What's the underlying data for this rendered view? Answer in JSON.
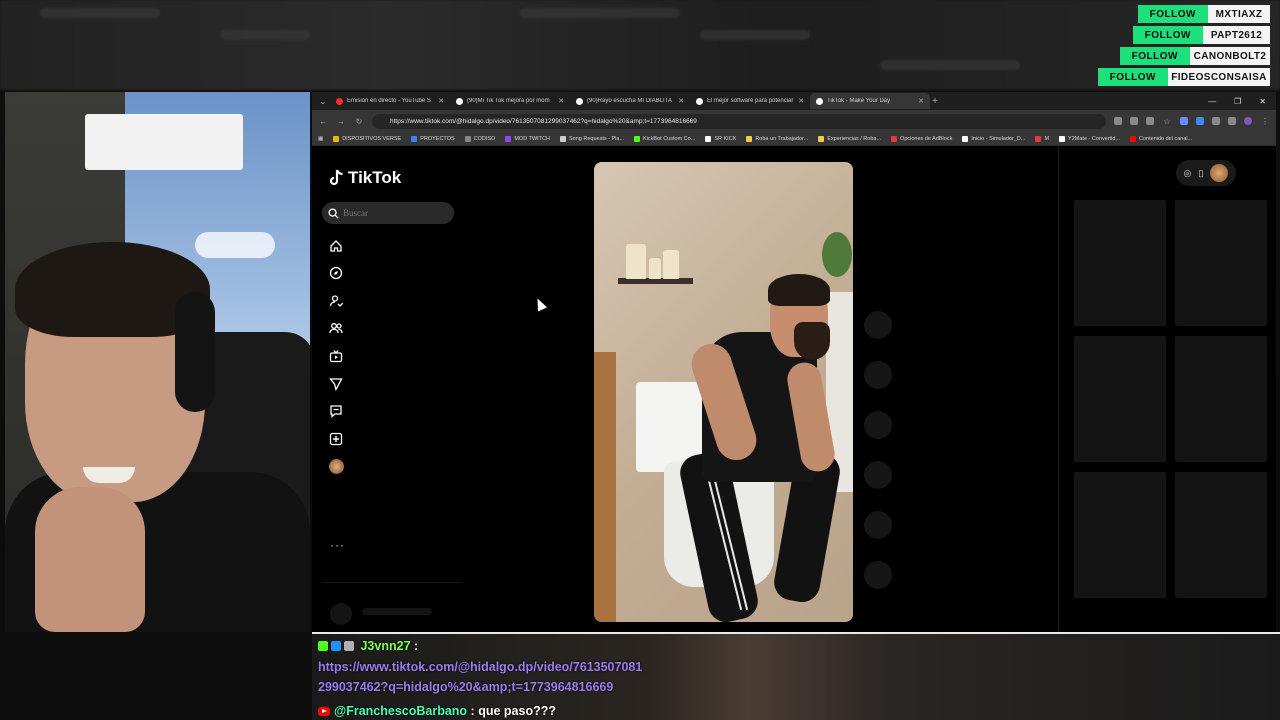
{
  "follows": [
    {
      "action": "FOLLOW",
      "name": "MXTIAXZ"
    },
    {
      "action": "FOLLOW",
      "name": "PAPT2612"
    },
    {
      "action": "FOLLOW",
      "name": "CANONBOLT2"
    },
    {
      "action": "FOLLOW",
      "name": "FIDEOSCONSAISA"
    }
  ],
  "browser": {
    "tabs": [
      {
        "title": "Emisión en directo - YouTube S",
        "favicon_color": "#ff2a2a"
      },
      {
        "title": "(90)Mi Tik Tok mejora por mom",
        "favicon_color": "#ffffff"
      },
      {
        "title": "(90)Rayo escucha MI DIABLITA",
        "favicon_color": "#ffffff"
      },
      {
        "title": "El mejor software para potenciar",
        "favicon_color": "#ffffff"
      },
      {
        "title": "TikTok - Make Your Day",
        "favicon_color": "#ffffff"
      }
    ],
    "new_tab": "+",
    "url": "https://www.tiktok.com/@hidalgo.dp/video/7613507081299037462?q=hidalgo%20&amp;t=1773964816669",
    "bookmarks": [
      {
        "label": "DISPOSITIVOS VERSE",
        "color": "#f0b400"
      },
      {
        "label": "PROYECTOS",
        "color": "#3b82f6"
      },
      {
        "label": "CODISO",
        "color": "#888888"
      },
      {
        "label": "MOD TWITCH",
        "color": "#9146ff"
      },
      {
        "label": "Song Requests - Pla...",
        "color": "#cccccc"
      },
      {
        "label": "KickBot Custom Co...",
        "color": "#53fc18"
      },
      {
        "label": "SR KICK",
        "color": "#ffffff"
      },
      {
        "label": "Roba un Trabajador...",
        "color": "#f7c948"
      },
      {
        "label": "Experiencias / Roba...",
        "color": "#f7c948"
      },
      {
        "label": "Opciones de AdBlock",
        "color": "#e53935"
      },
      {
        "label": "Inicio - Simulador_D...",
        "color": "#ffffff"
      },
      {
        "label": "M",
        "color": "#e53935"
      },
      {
        "label": "Y2Mate - Convertid...",
        "color": "#ffffff"
      },
      {
        "label": "Contenido del canal...",
        "color": "#ff0000"
      }
    ]
  },
  "tiktok": {
    "logo": "TikTok",
    "search_placeholder": "Buscar",
    "more": "···",
    "nav_icons": [
      "home-icon",
      "explore-icon",
      "following-icon",
      "friends-icon",
      "live-icon",
      "messages-send-icon",
      "inbox-icon",
      "upload-icon",
      "profile-avatar"
    ]
  },
  "chat": [
    {
      "user": "J3vnn27",
      "sep": ":",
      "message": "https://www.tiktok.com/@hidalgo.dp/video/7613507081",
      "message2": "299037462?q=hidalgo%20&amp;t=1773964816669",
      "badges": [
        "#53fc18",
        "#1e90ff",
        "#b0b0b0"
      ]
    },
    {
      "user": "@FranchescoBarbano",
      "sep": ":",
      "message": "que paso???",
      "platform": "youtube"
    }
  ]
}
